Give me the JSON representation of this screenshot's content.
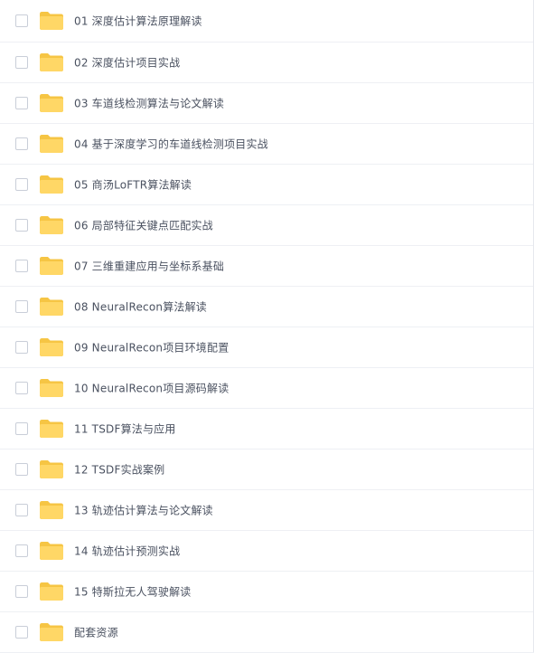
{
  "file_list": {
    "items": [
      {
        "name": "01 深度估计算法原理解读"
      },
      {
        "name": "02 深度估计项目实战"
      },
      {
        "name": "03 车道线检测算法与论文解读"
      },
      {
        "name": "04 基于深度学习的车道线检测项目实战"
      },
      {
        "name": "05 商汤LoFTR算法解读"
      },
      {
        "name": "06 局部特征关键点匹配实战"
      },
      {
        "name": "07 三维重建应用与坐标系基础"
      },
      {
        "name": "08 NeuralRecon算法解读"
      },
      {
        "name": "09 NeuralRecon项目环境配置"
      },
      {
        "name": "10 NeuralRecon项目源码解读"
      },
      {
        "name": "11 TSDF算法与应用"
      },
      {
        "name": "12 TSDF实战案例"
      },
      {
        "name": "13 轨迹估计算法与论文解读"
      },
      {
        "name": "14 轨迹估计预测实战"
      },
      {
        "name": "15 特斯拉无人驾驶解读"
      },
      {
        "name": "配套资源"
      }
    ],
    "icon": "folder-icon",
    "colors": {
      "folder_back": "#f6c544",
      "folder_front": "#ffd766",
      "checkbox_border": "#c9ced8",
      "row_divider": "#eef0f4",
      "text": "#4a5160"
    }
  }
}
